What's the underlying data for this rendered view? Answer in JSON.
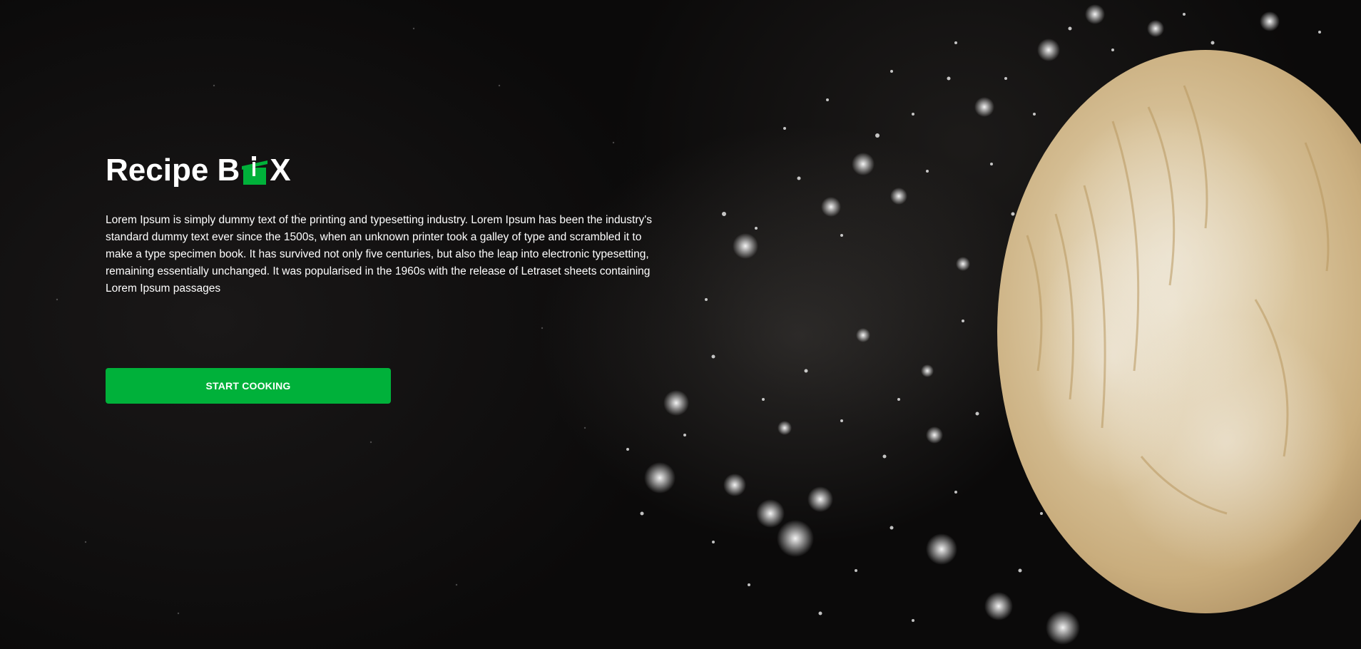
{
  "brand": {
    "name_left": "Recipe B",
    "name_right": "X",
    "accent_color": "#00b13a",
    "logo_icon": "pot-icon"
  },
  "hero": {
    "description": "Lorem Ipsum is simply dummy text of the printing and typesetting industry. Lorem Ipsum has been the industry's standard dummy text ever since the 1500s, when an unknown printer took a galley of type and scrambled it to make a type specimen book. It has survived not only five centuries, but also the leap into electronic typesetting, remaining essentially unchanged. It was popularised in the 1960s with the release of Letraset sheets containing Lorem Ipsum passages",
    "cta_label": "START COOKING",
    "background_image": "bread-dough-flour-photo"
  }
}
